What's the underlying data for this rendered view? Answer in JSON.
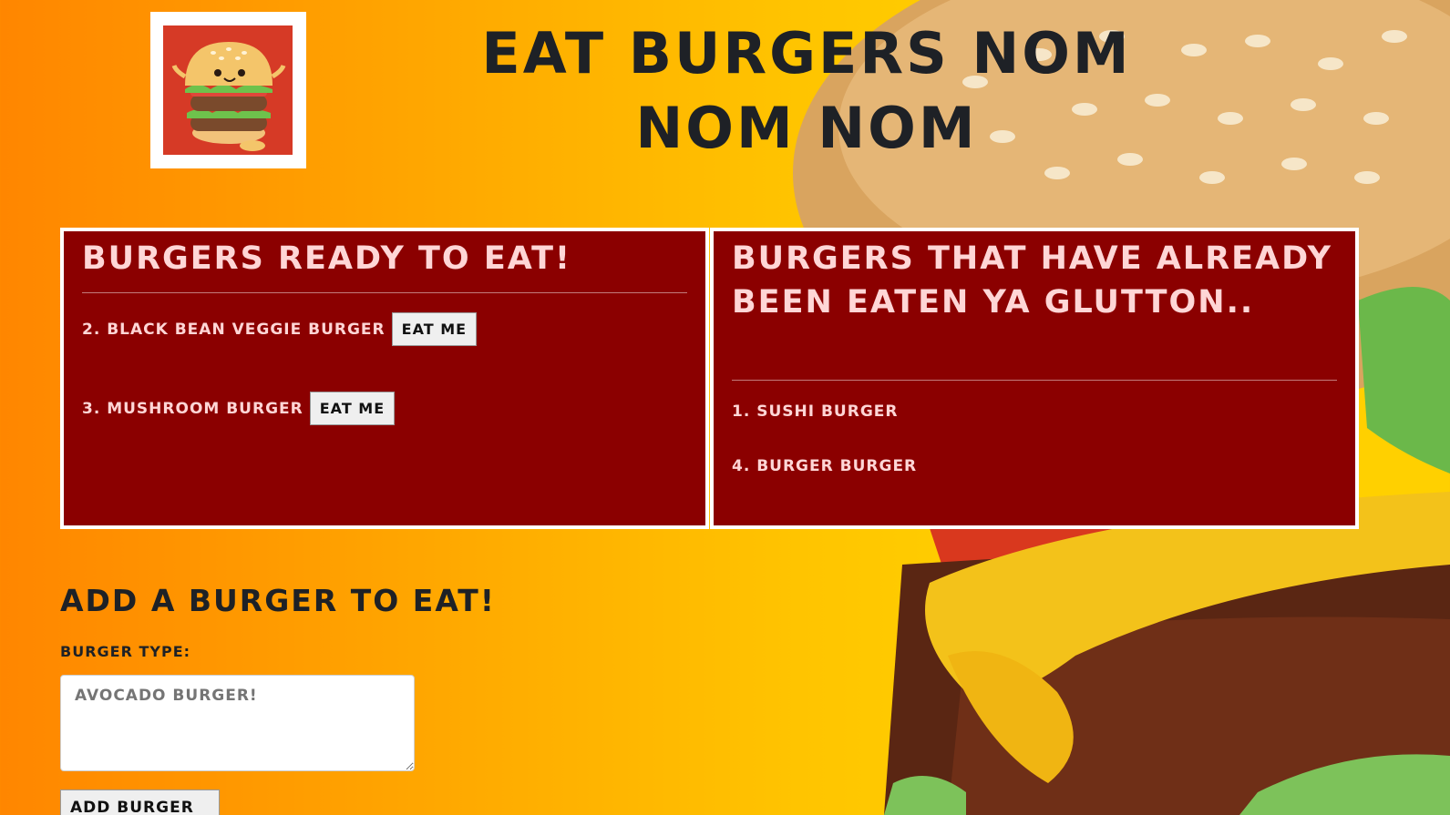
{
  "header": {
    "logo_alt": "cartoon-burger-logo",
    "title": "Eat Burgers Nom Nom Nom"
  },
  "ready": {
    "heading": "Burgers ready to eat!",
    "items": [
      {
        "label": "2. Black Bean Veggie Burger",
        "button": "Eat Me"
      },
      {
        "label": "3. Mushroom Burger",
        "button": "Eat Me"
      }
    ]
  },
  "eaten": {
    "heading": "Burgers that have already been eaten ya glutton..",
    "items": [
      {
        "label": "1. Sushi Burger"
      },
      {
        "label": "4. Burger Burger"
      }
    ]
  },
  "form": {
    "heading": "Add a Burger to eat!",
    "label": "Burger type:",
    "placeholder": "Avocado burger!",
    "submit": "Add burger"
  },
  "colors": {
    "panel_bg": "#8b0000",
    "panel_text": "#ffd6d6",
    "heading_dark": "#1e2126",
    "bg_orange": "#ff8600",
    "bg_yellow": "#ffd000"
  }
}
